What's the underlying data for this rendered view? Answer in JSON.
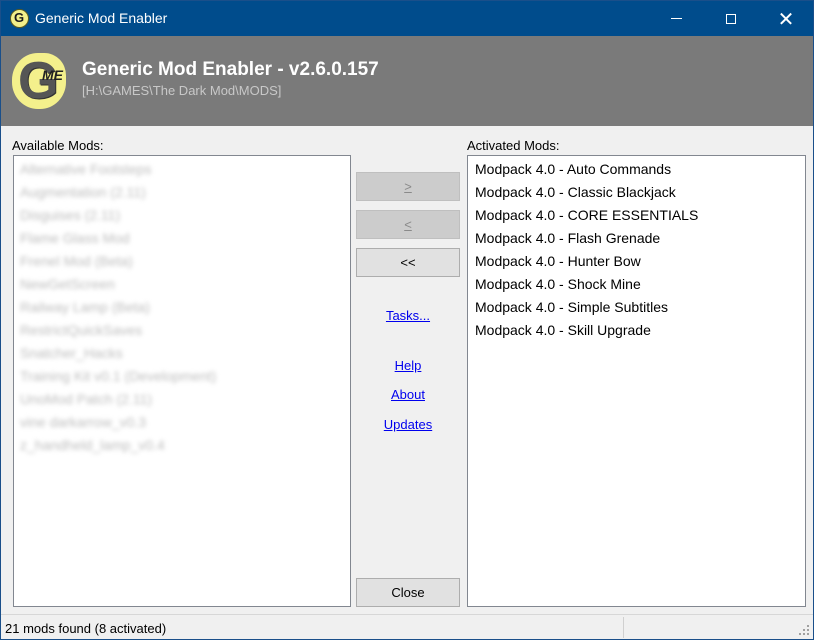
{
  "window": {
    "title": "Generic Mod Enabler",
    "icon": "gme-icon"
  },
  "header": {
    "logo_letter": "G",
    "logo_sub": "ME",
    "app_name": "Generic Mod Enabler - v2.6.0.157",
    "mods_path": "[H:\\GAMES\\The Dark Mod\\MODS]"
  },
  "available": {
    "label": "Available Mods:",
    "items": [
      "Alternative Footsteps",
      "Augmentation (2.11)",
      "Disguises (2.11)",
      "Flame Glass Mod",
      "Frenel Mod (Beta)",
      "NewGetScreen",
      "Railway Lamp (Beta)",
      "RestrictQuickSaves",
      "Snatcher_Hacks",
      "Training Kit v0.1 (Development)",
      "UnoMod Patch (2.11)",
      "vine darkarrow_v0.3",
      "z_handheld_lamp_v0.4"
    ]
  },
  "activated": {
    "label": "Activated Mods:",
    "items": [
      "Modpack 4.0 - Auto Commands",
      "Modpack 4.0 - Classic Blackjack",
      "Modpack 4.0 - CORE ESSENTIALS",
      "Modpack 4.0 - Flash Grenade",
      "Modpack 4.0 - Hunter Bow",
      "Modpack 4.0 - Shock Mine",
      "Modpack 4.0 - Simple Subtitles",
      "Modpack 4.0 - Skill Upgrade"
    ]
  },
  "buttons": {
    "add": ">",
    "remove": "<",
    "remove_all": "<<",
    "close": "Close"
  },
  "links": {
    "tasks": "Tasks...",
    "help": "Help",
    "about": "About",
    "updates": "Updates"
  },
  "status": {
    "text": "21 mods found (8 activated)"
  },
  "colors": {
    "titlebar": "#004c8c",
    "header": "#7a7a7a",
    "logo": "#f4f08c",
    "link": "#0000ee"
  }
}
